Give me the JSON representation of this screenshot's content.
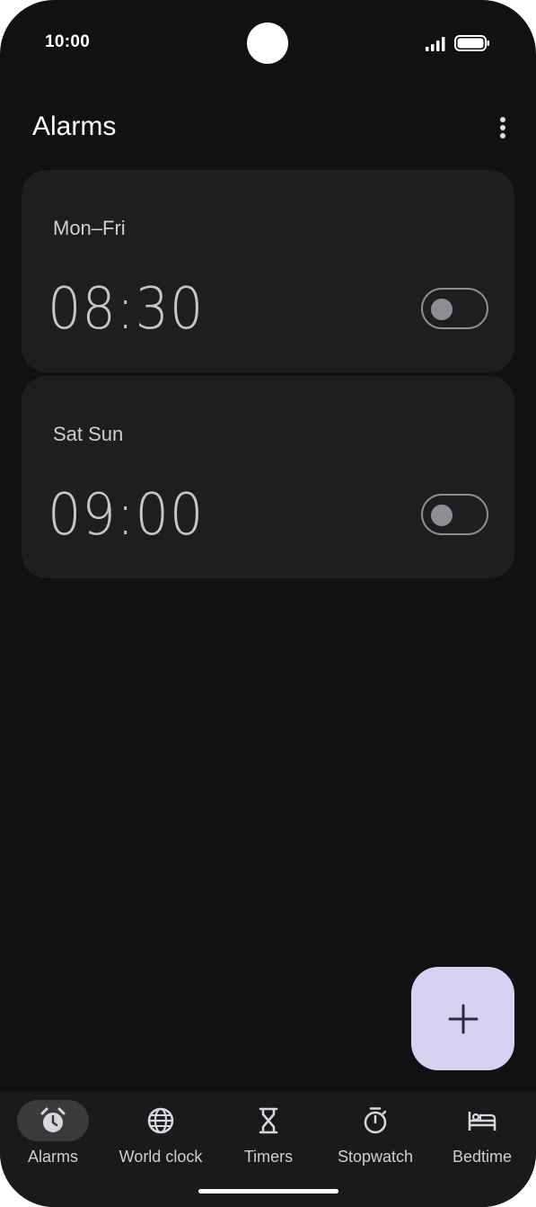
{
  "status_bar": {
    "time": "10:00"
  },
  "header": {
    "title": "Alarms"
  },
  "alarms": [
    {
      "days": "Mon–Fri",
      "time": "08:30",
      "enabled": false
    },
    {
      "days": "Sat Sun",
      "time": "09:00",
      "enabled": false
    }
  ],
  "fab": {
    "icon": "plus-icon"
  },
  "bottom_nav": {
    "items": [
      {
        "label": "Alarms",
        "icon": "alarm-clock-icon",
        "active": true
      },
      {
        "label": "World clock",
        "icon": "globe-icon",
        "active": false
      },
      {
        "label": "Timers",
        "icon": "hourglass-icon",
        "active": false
      },
      {
        "label": "Stopwatch",
        "icon": "stopwatch-icon",
        "active": false
      },
      {
        "label": "Bedtime",
        "icon": "bed-icon",
        "active": false
      }
    ]
  },
  "colors": {
    "background": "#111113",
    "card": "#1e1e20",
    "fab": "#d9d1f1",
    "nav_active_pill": "#3a3a3d"
  }
}
